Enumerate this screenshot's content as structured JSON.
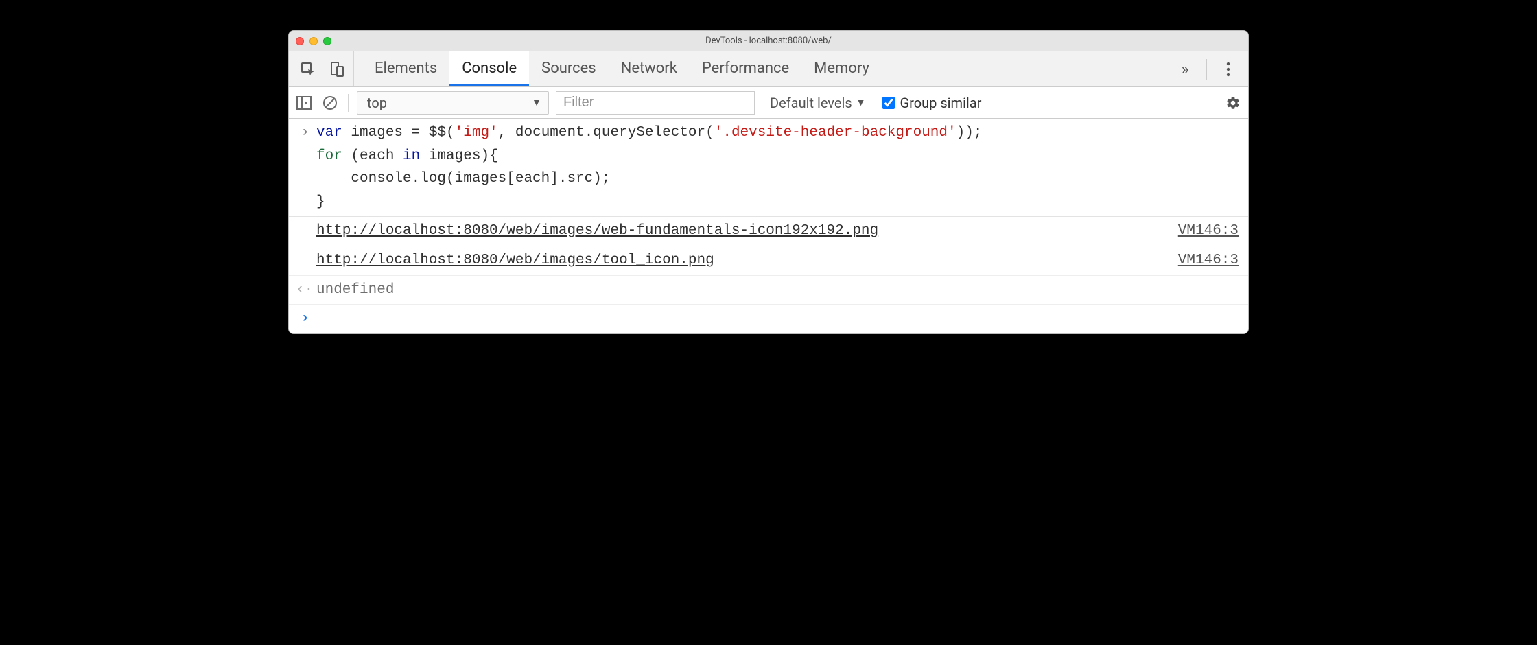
{
  "window": {
    "title": "DevTools - localhost:8080/web/"
  },
  "tabs": {
    "items": [
      "Elements",
      "Console",
      "Sources",
      "Network",
      "Performance",
      "Memory"
    ],
    "active": "Console",
    "overflow_glyph": "»"
  },
  "toolbar": {
    "context": "top",
    "filter_placeholder": "Filter",
    "levels_label": "Default levels",
    "group_similar_label": "Group similar",
    "group_similar_checked": true
  },
  "console": {
    "input_code": "var images = $$('img', document.querySelector('.devsite-header-background'));\nfor (each in images){\n    console.log(images[each].src);\n}",
    "code_tokens": [
      {
        "t": "var ",
        "c": "kw"
      },
      {
        "t": "images",
        "c": ""
      },
      {
        "t": " = $$(",
        "c": ""
      },
      {
        "t": "'img'",
        "c": "str"
      },
      {
        "t": ", document.querySelector(",
        "c": ""
      },
      {
        "t": "'.devsite-header-background'",
        "c": "str"
      },
      {
        "t": "));\n",
        "c": ""
      },
      {
        "t": "for",
        "c": "kw2"
      },
      {
        "t": " (each ",
        "c": ""
      },
      {
        "t": "in",
        "c": "kw"
      },
      {
        "t": " images){\n    console.log(images[each].src);\n}",
        "c": ""
      }
    ],
    "logs": [
      {
        "text": "http://localhost:8080/web/images/web-fundamentals-icon192x192.png",
        "source": "VM146:3"
      },
      {
        "text": "http://localhost:8080/web/images/tool_icon.png",
        "source": "VM146:3"
      }
    ],
    "return_value": "undefined"
  }
}
